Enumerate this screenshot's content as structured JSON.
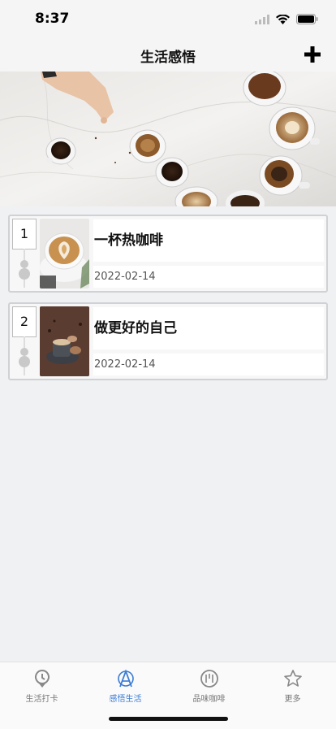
{
  "status": {
    "time": "8:37"
  },
  "nav": {
    "title": "生活感悟",
    "add_icon": "plus-icon"
  },
  "entries": [
    {
      "index": "1",
      "title": "一杯热咖啡",
      "date": "2022-02-14",
      "thumb": "latte-art-photo"
    },
    {
      "index": "2",
      "title": "做更好的自己",
      "date": "2022-02-14",
      "thumb": "coffee-macarons-photo"
    }
  ],
  "tabs": [
    {
      "label": "生活打卡",
      "icon": "clock-pin-icon",
      "active": false
    },
    {
      "label": "感悟生活",
      "icon": "compass-a-icon",
      "active": true
    },
    {
      "label": "品味咖啡",
      "icon": "coffee-circle-icon",
      "active": false
    },
    {
      "label": "更多",
      "icon": "star-icon",
      "active": false
    }
  ],
  "colors": {
    "accent": "#3a7bd5",
    "inactive": "#777777",
    "background": "#f0f1f3"
  }
}
